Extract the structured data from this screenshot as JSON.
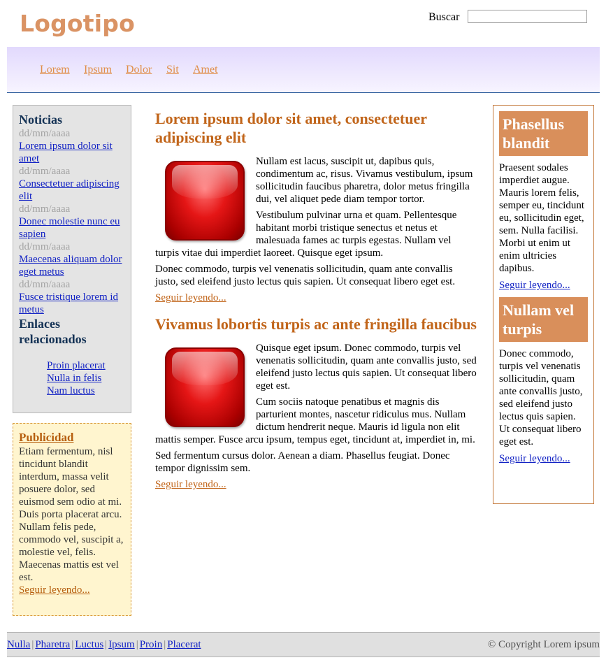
{
  "header": {
    "logo": "Logotipo",
    "search_label": "Buscar",
    "search_placeholder": ""
  },
  "nav": [
    "Lorem",
    "Ipsum",
    "Dolor",
    "Sit",
    "Amet"
  ],
  "sidebar": {
    "news_title": "Noticias",
    "news": [
      {
        "date": "dd/mm/aaaa",
        "title": "Lorem ipsum dolor sit amet"
      },
      {
        "date": "dd/mm/aaaa",
        "title": "Consectetuer adipiscing elit"
      },
      {
        "date": "dd/mm/aaaa",
        "title": "Donec molestie nunc eu sapien"
      },
      {
        "date": "dd/mm/aaaa",
        "title": "Maecenas aliquam dolor eget metus"
      },
      {
        "date": "dd/mm/aaaa",
        "title": "Fusce tristique lorem id metus"
      }
    ],
    "links_title": "Enlaces relacionados",
    "links": [
      "Proin placerat",
      "Nulla in felis",
      "Nam luctus"
    ]
  },
  "ad": {
    "title": "Publicidad",
    "text1": "Etiam fermentum, nisl tincidunt blandit interdum, massa velit posuere dolor, sed euismod sem odio at mi.",
    "text2": "Duis porta placerat arcu. Nullam felis pede, commodo vel, suscipit a, molestie vel, felis. Maecenas mattis est vel est.",
    "more": "Seguir leyendo..."
  },
  "articles": [
    {
      "title": "Lorem ipsum dolor sit amet, consectetuer adipiscing elit",
      "paragraphs": [
        "Nullam est lacus, suscipit ut, dapibus quis, condimentum ac, risus. Vivamus vestibulum, ipsum sollicitudin faucibus pharetra, dolor metus fringilla dui, vel aliquet pede diam tempor tortor.",
        "Vestibulum pulvinar urna et quam. Pellentesque habitant morbi tristique senectus et netus et malesuada fames ac turpis egestas. Nullam vel turpis vitae dui imperdiet laoreet. Quisque eget ipsum.",
        "Donec commodo, turpis vel venenatis sollicitudin, quam ante convallis justo, sed eleifend justo lectus quis sapien. Ut consequat libero eget est."
      ],
      "more": "Seguir leyendo..."
    },
    {
      "title": "Vivamus lobortis turpis ac ante fringilla faucibus",
      "paragraphs": [
        "Quisque eget ipsum. Donec commodo, turpis vel venenatis sollicitudin, quam ante convallis justo, sed eleifend justo lectus quis sapien. Ut consequat libero eget est.",
        "Cum sociis natoque penatibus et magnis dis parturient montes, nascetur ridiculus mus. Nullam dictum hendrerit neque. Mauris id ligula non elit mattis semper. Fusce arcu ipsum, tempus eget, tincidunt at, imperdiet in, mi.",
        "Sed fermentum cursus dolor. Aenean a diam. Phasellus feugiat. Donec tempor dignissim sem."
      ],
      "more": "Seguir leyendo..."
    }
  ],
  "right": [
    {
      "title": "Phasellus blandit",
      "text": "Praesent sodales imperdiet augue. Mauris lorem felis, semper eu, tincidunt eu, sollicitudin eget, sem. Nulla facilisi. Morbi ut enim ut enim ultricies dapibus.",
      "more": "Seguir leyendo..."
    },
    {
      "title": "Nullam vel turpis",
      "text": "Donec commodo, turpis vel venenatis sollicitudin, quam ante convallis justo, sed eleifend justo lectus quis sapien. Ut consequat libero eget est.",
      "more": "Seguir leyendo..."
    }
  ],
  "footer": {
    "links": [
      "Nulla",
      "Pharetra",
      "Luctus",
      "Ipsum",
      "Proin",
      "Placerat"
    ],
    "separator": "|",
    "copyright": "© Copyright Lorem ipsum"
  },
  "colors": {
    "accent": "#c1651a",
    "logo": "#da9364",
    "link": "#1222c4",
    "nav_bg": "#e2d9fd",
    "box_title_bg": "#d98f5b"
  }
}
